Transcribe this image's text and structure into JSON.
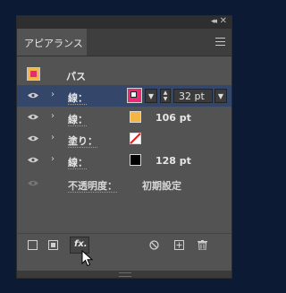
{
  "panel": {
    "tab_label": "アピアランス",
    "header_label": "パス",
    "colors": {
      "accent_pink": "#e82b73",
      "accent_orange": "#f3b546",
      "selected_row": "#34476a"
    }
  },
  "rows": [
    {
      "label": "線：",
      "swatch": "pink-with-white-square",
      "value": "32 pt",
      "selected": true
    },
    {
      "label": "線：",
      "swatch": "orange",
      "value": "106 pt"
    },
    {
      "label": "塗り：",
      "swatch": "none-red-slash",
      "value": ""
    },
    {
      "label": "線：",
      "swatch": "black",
      "value": "128 pt"
    }
  ],
  "opacity": {
    "label": "不透明度：",
    "value": "初期設定"
  },
  "toolbar": {
    "fx_label": "fx.",
    "icons": [
      "add-stroke-icon",
      "add-fill-icon",
      "fx-icon",
      "clear-appearance-icon",
      "duplicate-icon",
      "delete-icon"
    ]
  }
}
